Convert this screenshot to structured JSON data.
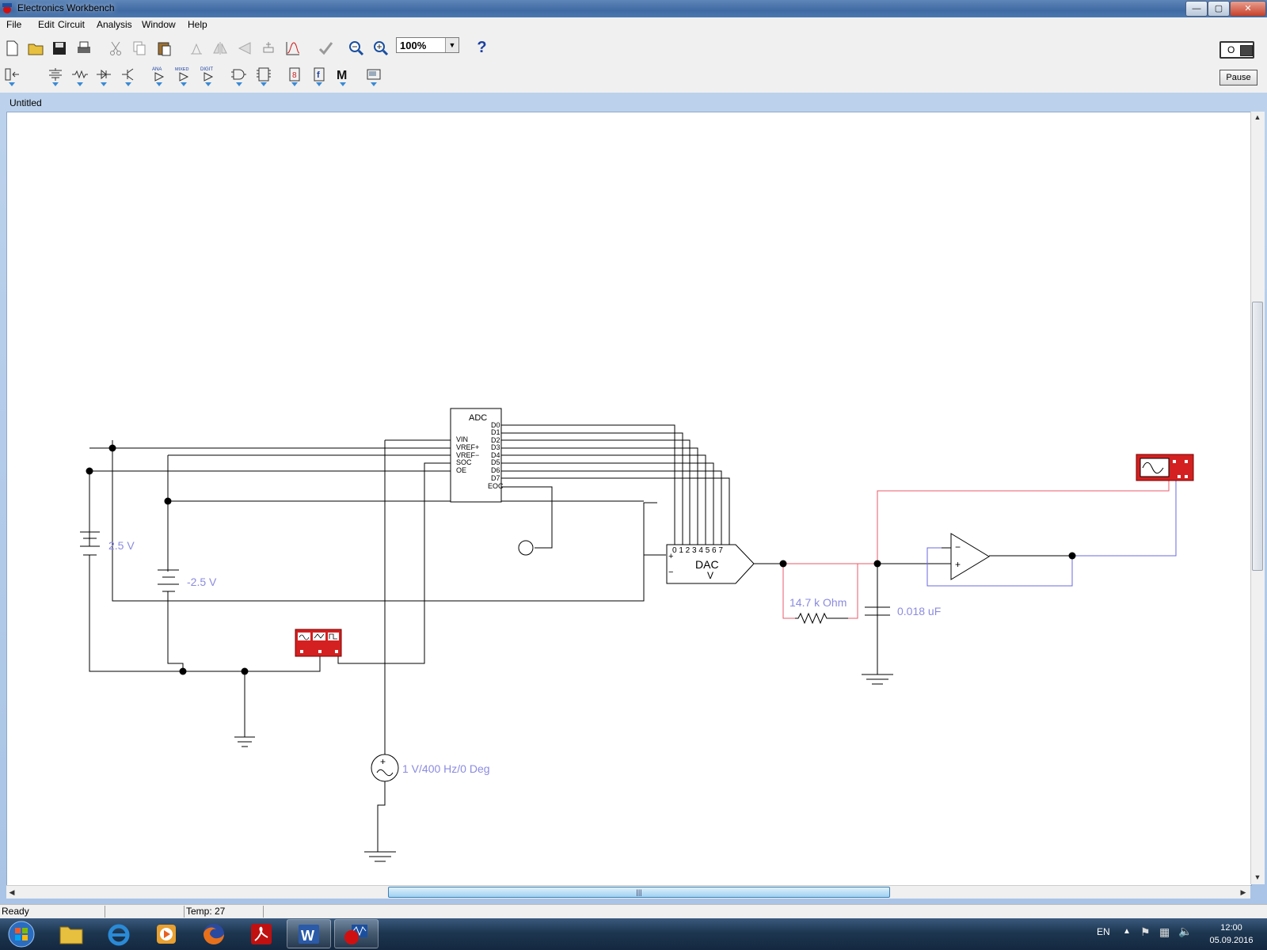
{
  "window": {
    "title": "Electronics Workbench",
    "min": "—",
    "max": "▢",
    "close": "✕"
  },
  "menu": [
    "File",
    "Edit",
    "Circuit",
    "Analysis",
    "Window",
    "Help"
  ],
  "toolbar": {
    "zoom": "100%",
    "help": "?",
    "pause": "Pause",
    "power_on": "I",
    "power_off": "O",
    "parts_labels": [
      "ANA",
      "MIXED",
      "DIGIT"
    ]
  },
  "document": {
    "title": "Untitled"
  },
  "circuit": {
    "adc_label": "ADC",
    "adc_inputs": [
      "VIN",
      "VREF+",
      "VREF−",
      "SOC",
      "OE"
    ],
    "adc_outputs": [
      "D0",
      "D1",
      "D2",
      "D3",
      "D4",
      "D5",
      "D6",
      "D7",
      "EOC"
    ],
    "dac_label": "DAC",
    "dac_unit": "V",
    "dac_pins": "0 1 2 3 4 5 6 7",
    "battery1": "2.5 V",
    "battery2": "-2.5 V",
    "resistor": "14.7 k Ohm",
    "capacitor": "0.018 uF",
    "source": "1 V/400 Hz/0 Deg"
  },
  "status": {
    "ready": "Ready",
    "temp": "Temp:  27"
  },
  "taskbar": {
    "lang": "EN",
    "time": "12:00",
    "date": "05.09.2016"
  },
  "colors": {
    "wire": "#000000",
    "red_wire": "#e85a6a",
    "blue_wire": "#6a6ae0",
    "instrument": "#d42020",
    "label": "#8b8be0"
  }
}
